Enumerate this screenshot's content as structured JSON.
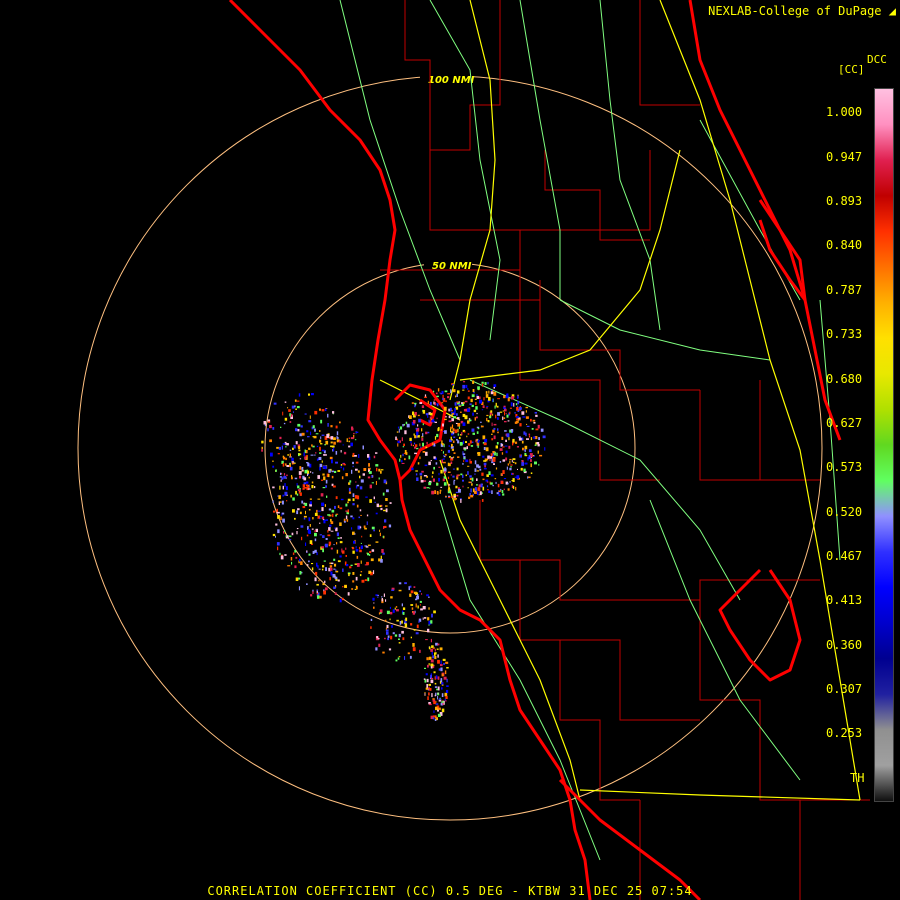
{
  "credit": "NEXLAB-College of DuPage",
  "footer": "CORRELATION COEFFICIENT (CC) 0.5 DEG - KTBW 31 DEC 25 07:54",
  "legend": {
    "unit": "[CC]",
    "product": "DCC",
    "ticks": [
      "1.000",
      "0.947",
      "0.893",
      "0.840",
      "0.787",
      "0.733",
      "0.680",
      "0.627",
      "0.573",
      "0.520",
      "0.467",
      "0.413",
      "0.360",
      "0.307",
      "0.253",
      "TH"
    ],
    "colors": [
      "#ffc0e0",
      "#ff90c0",
      "#e02050",
      "#c00000",
      "#ff3000",
      "#ff7000",
      "#ffb000",
      "#ffe000",
      "#e8e800",
      "#b0e000",
      "#60d820",
      "#60ff60",
      "#9090ff",
      "#3030ff",
      "#0000ff",
      "#0000cc",
      "#000090",
      "#2020a0",
      "#909090",
      "#a0a0a0",
      "#101010"
    ]
  },
  "rings": [
    {
      "label": "100 NMI"
    },
    {
      "label": "50 NMI"
    }
  ],
  "colors": {
    "coast": "#ff0000",
    "county": "#c00000",
    "highway": "#ffff00",
    "road": "#80ff80",
    "ring": "#ffc080"
  }
}
